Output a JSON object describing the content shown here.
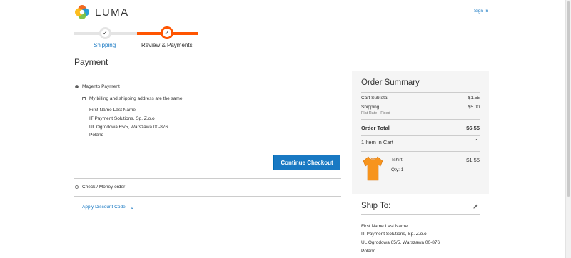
{
  "header": {
    "logo_text": "LUMA",
    "signin_label": "Sign In"
  },
  "progress": {
    "steps": [
      {
        "label": "Shipping",
        "state": "complete"
      },
      {
        "label": "Review & Payments",
        "state": "active"
      }
    ],
    "check_glyph": "✓"
  },
  "payment": {
    "title": "Payment",
    "methods": [
      {
        "label": "Magento Payment",
        "selected": true
      },
      {
        "label": "Check / Money order",
        "selected": false
      }
    ],
    "same_address_label": "My billing and shipping address are the same",
    "same_address_checked": true,
    "billing_address": [
      "First Name Last Name",
      "IT Payment Solutions, Sp. Z.o.o",
      "UL Ogrodowa 65/5, Warszawa 00-876",
      "Poland"
    ],
    "continue_label": "Continue Checkout",
    "discount_label": "Apply Discount Code"
  },
  "summary": {
    "title": "Order Summary",
    "cart_subtotal_label": "Cart Subtotal",
    "cart_subtotal_value": "$1.55",
    "shipping_label": "Shipping",
    "shipping_method": "Flat Rate - Fixed",
    "shipping_value": "$5.00",
    "order_total_label": "Order Total",
    "order_total_value": "$6.55",
    "items_in_cart_label": "1 Item in Cart",
    "items": [
      {
        "name": "Tshirt",
        "qty_label": "Qty: 1",
        "price": "$1.55",
        "image_color": "#f7941d"
      }
    ]
  },
  "ship_to": {
    "title": "Ship To:",
    "address": [
      "First Name Last Name",
      "IT Payment Solutions, Sp. Z.o.o",
      "UL Ogrodowa 65/5, Warszawa 00-876",
      "Poland"
    ]
  },
  "colors": {
    "accent_orange": "#ff5501",
    "link_blue": "#1979c3",
    "button_blue": "#1979c3",
    "summary_bg": "#f5f5f5"
  }
}
